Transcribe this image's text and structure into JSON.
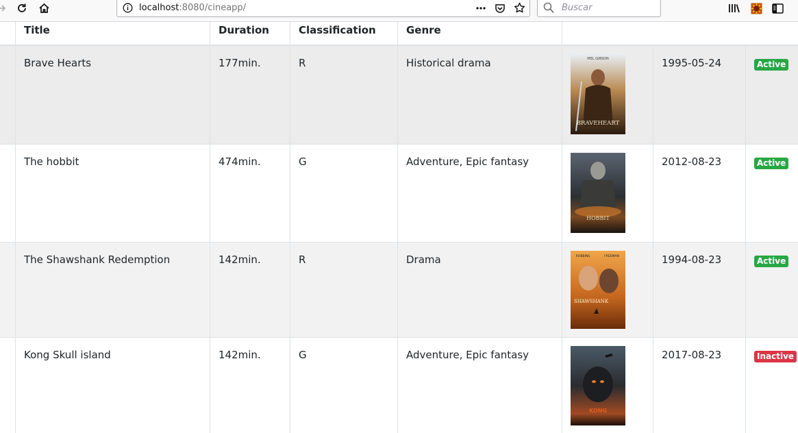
{
  "browser": {
    "url_host": "localhost",
    "url_rest": ":8080/cineapp/",
    "search_placeholder": "Buscar"
  },
  "table": {
    "headers": [
      "Title",
      "Duration",
      "Classification",
      "Genre"
    ],
    "rows": [
      {
        "title": "Brave Hearts",
        "duration": "177min.",
        "classification": "R",
        "genre": "Historical drama",
        "date": "1995-05-24",
        "status": "Active",
        "poster_text": [
          "MEL GIBSON",
          "BRAVEHEART"
        ]
      },
      {
        "title": "The hobbit",
        "duration": "474min.",
        "classification": "G",
        "genre": "Adventure, Epic fantasy",
        "date": "2012-08-23",
        "status": "Active",
        "poster_text": [
          "HOBBIT"
        ]
      },
      {
        "title": "The Shawshank Redemption",
        "duration": "142min.",
        "classification": "R",
        "genre": "Drama",
        "date": "1994-08-23",
        "status": "Active",
        "poster_text": [
          "ROBBINS",
          "FREEMAN",
          "SHAWSHANK"
        ]
      },
      {
        "title": "Kong Skull island",
        "duration": "142min.",
        "classification": "G",
        "genre": "Adventure, Epic fantasy",
        "date": "2017-08-23",
        "status": "Inactive",
        "poster_text": [
          "KONG"
        ]
      }
    ]
  },
  "colors": {
    "active": "#28a745",
    "inactive": "#dc3545"
  },
  "icons": [
    "arrow-right-icon",
    "reload-icon",
    "home-icon",
    "info-icon",
    "more-icon",
    "pocket-icon",
    "star-icon",
    "search-icon",
    "library-icon",
    "extension-icon",
    "sidebar-icon"
  ]
}
